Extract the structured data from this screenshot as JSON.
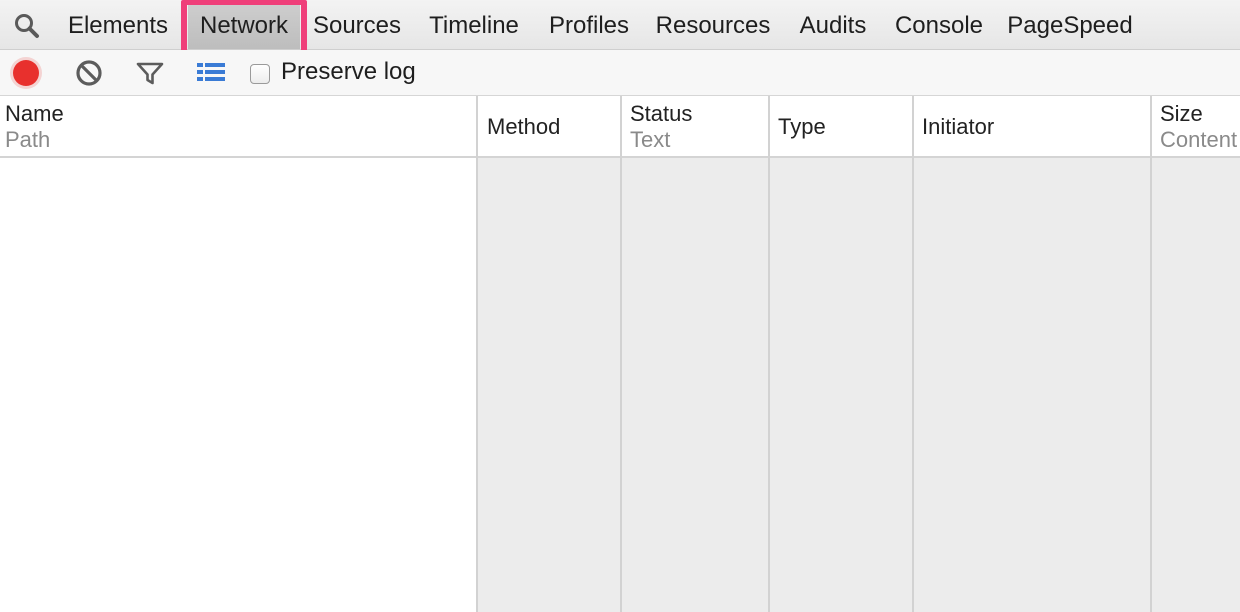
{
  "tabs": [
    {
      "label": "Elements"
    },
    {
      "label": "Network",
      "selected": true
    },
    {
      "label": "Sources"
    },
    {
      "label": "Timeline"
    },
    {
      "label": "Profiles"
    },
    {
      "label": "Resources"
    },
    {
      "label": "Audits"
    },
    {
      "label": "Console"
    },
    {
      "label": "PageSpeed"
    }
  ],
  "toolbar": {
    "icons": [
      "record-icon",
      "clear-icon",
      "filter-icon",
      "view-list-icon"
    ],
    "preserve_log_label": "Preserve log",
    "preserve_log_checked": false
  },
  "columns": [
    {
      "primary": "Name",
      "secondary": "Path"
    },
    {
      "primary": "Method",
      "secondary": ""
    },
    {
      "primary": "Status",
      "secondary": "Text"
    },
    {
      "primary": "Type",
      "secondary": ""
    },
    {
      "primary": "Initiator",
      "secondary": ""
    },
    {
      "primary": "Size",
      "secondary": "Content"
    }
  ],
  "rows": [],
  "colors": {
    "accent_highlight": "#ef3f7a",
    "record": "#e8302d",
    "toolbar_icon_blue": "#3a7bd5",
    "grid_shade": "#ececec"
  }
}
